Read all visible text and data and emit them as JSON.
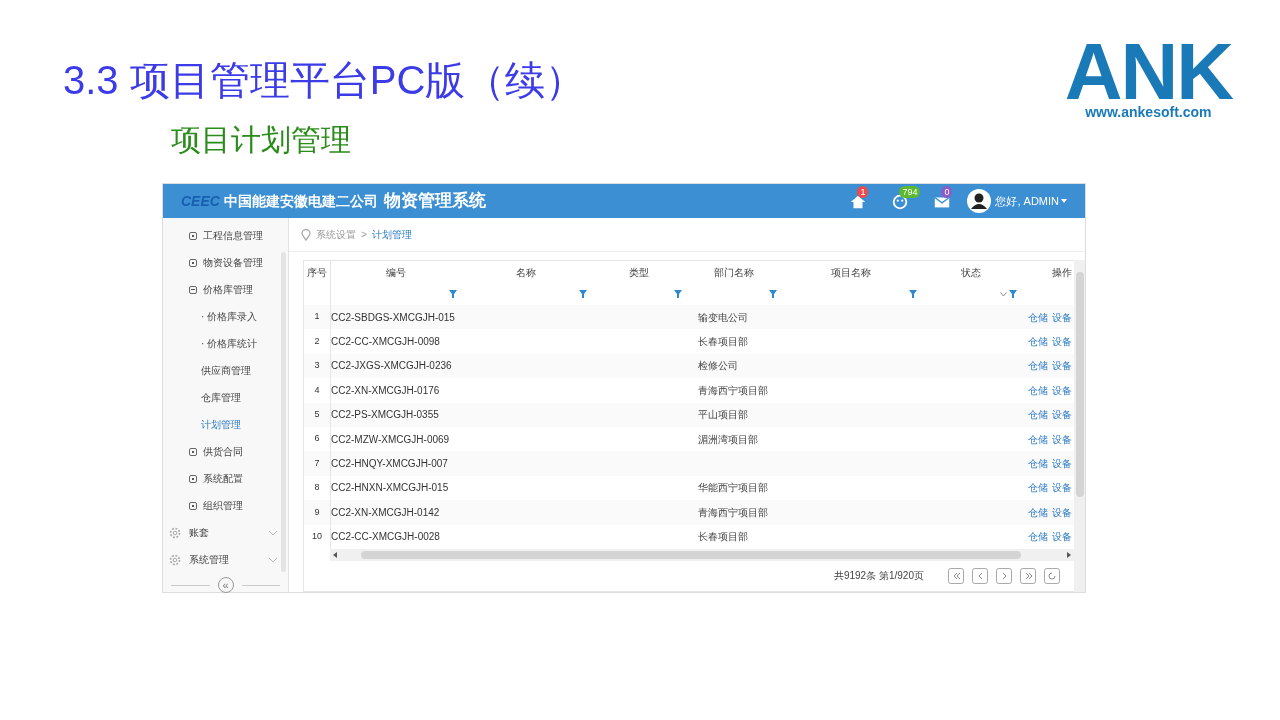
{
  "slide": {
    "title": "3.3 项目管理平台PC版（续）",
    "subtitle": "项目计划管理",
    "logo": {
      "letters": "ANK",
      "url": "www.ankesoft.com"
    }
  },
  "app": {
    "brand": "CEEC",
    "title": "中国能建安徽电建二公司",
    "system": "物资管理系统",
    "notifications": [
      {
        "kind": "home",
        "count": "1",
        "color": "#e84c4c"
      },
      {
        "kind": "face",
        "count": "794",
        "color": "#5cb82e"
      },
      {
        "kind": "mail",
        "count": "0",
        "color": "#8a5cc8"
      }
    ],
    "user": "您好, ADMIN",
    "sidebar": {
      "items": [
        {
          "label": "工程信息管理",
          "expanded": false
        },
        {
          "label": "物资设备管理",
          "expanded": false
        },
        {
          "label": "价格库管理",
          "expanded": true,
          "children": [
            {
              "label": "· 价格库录入",
              "selected": false
            },
            {
              "label": "· 价格库统计",
              "selected": false
            },
            {
              "label": "供应商管理",
              "selected": false
            },
            {
              "label": "仓库管理",
              "selected": false
            },
            {
              "label": "计划管理",
              "selected": true
            }
          ]
        },
        {
          "label": "供货合同",
          "expanded": false
        },
        {
          "label": "系统配置",
          "expanded": false
        },
        {
          "label": "组织管理",
          "expanded": false
        }
      ],
      "sections": [
        "账套",
        "系统管理"
      ],
      "collapse": "«"
    },
    "breadcrumb": [
      "系统设置",
      "计划管理"
    ],
    "breadcrumb_separator": ">",
    "table": {
      "columns": [
        {
          "label": "序号",
          "filter": false,
          "dropdown": false
        },
        {
          "label": "编号",
          "filter": true,
          "dropdown": false
        },
        {
          "label": "名称",
          "filter": true,
          "dropdown": false
        },
        {
          "label": "类型",
          "filter": true,
          "dropdown": false
        },
        {
          "label": "部门名称",
          "filter": true,
          "dropdown": false
        },
        {
          "label": "项目名称",
          "filter": true,
          "dropdown": false
        },
        {
          "label": "状态",
          "filter": true,
          "dropdown": true
        },
        {
          "label": "操作",
          "filter": false,
          "dropdown": false
        }
      ],
      "rows": [
        {
          "no": "1",
          "code": "CC2-SBDGS-XMCGJH-015",
          "dept": "输变电公司",
          "actions": [
            "仓储",
            "设备"
          ]
        },
        {
          "no": "2",
          "code": "CC2-CC-XMCGJH-0098",
          "dept": "长春项目部",
          "actions": [
            "仓储",
            "设备"
          ]
        },
        {
          "no": "3",
          "code": "CC2-JXGS-XMCGJH-0236",
          "dept": "检修公司",
          "actions": [
            "仓储",
            "设备"
          ]
        },
        {
          "no": "4",
          "code": "CC2-XN-XMCGJH-0176",
          "dept": "青海西宁项目部",
          "actions": [
            "仓储",
            "设备"
          ]
        },
        {
          "no": "5",
          "code": "CC2-PS-XMCGJH-0355",
          "dept": "平山项目部",
          "actions": [
            "仓储",
            "设备"
          ]
        },
        {
          "no": "6",
          "code": "CC2-MZW-XMCGJH-0069",
          "dept": "湄洲湾项目部",
          "actions": [
            "仓储",
            "设备"
          ]
        },
        {
          "no": "7",
          "code": "CC2-HNQY-XMCGJH-007",
          "actions": [
            "仓储",
            "设备"
          ]
        },
        {
          "no": "8",
          "code": "CC2-HNXN-XMCGJH-015",
          "dept": "华能西宁项目部",
          "actions": [
            "仓储",
            "设备"
          ]
        },
        {
          "no": "9",
          "code": "CC2-XN-XMCGJH-0142",
          "dept": "青海西宁项目部",
          "actions": [
            "仓储",
            "设备"
          ]
        },
        {
          "no": "10",
          "code": "CC2-CC-XMCGJH-0028",
          "dept": "长春项目部",
          "actions": [
            "仓储",
            "设备"
          ]
        }
      ]
    },
    "pagination": {
      "summary": "共9192条 第1/920页",
      "buttons": [
        {
          "kind": "first"
        },
        {
          "kind": "prev"
        },
        {
          "kind": "next"
        },
        {
          "kind": "last"
        },
        {
          "kind": "refresh"
        }
      ]
    }
  }
}
